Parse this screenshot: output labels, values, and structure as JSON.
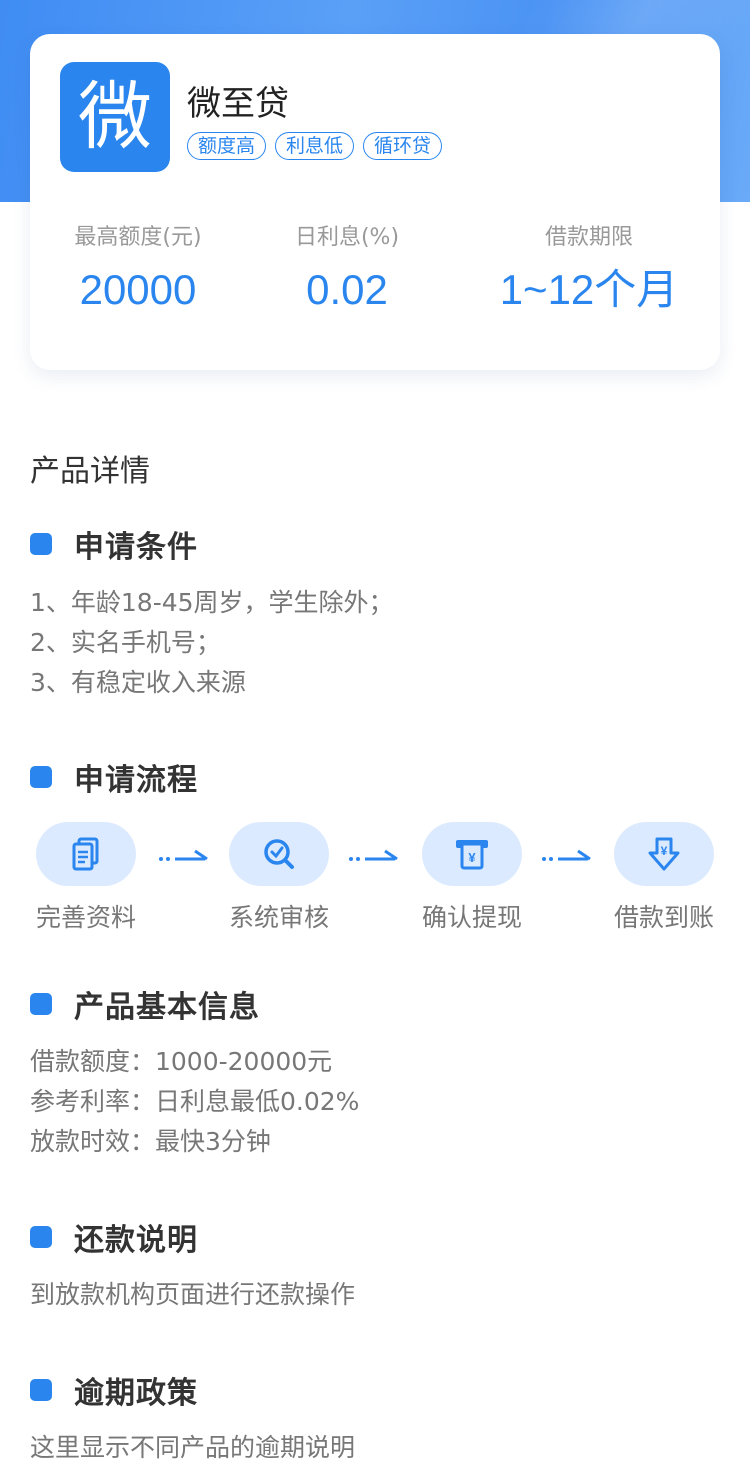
{
  "product": {
    "logo_char": "微",
    "name": "微至贷",
    "tags": [
      "额度高",
      "利息低",
      "循环贷"
    ]
  },
  "stats": [
    {
      "label": "最高额度(元)",
      "value": "20000"
    },
    {
      "label": "日利息(%)",
      "value": "0.02"
    },
    {
      "label": "借款期限",
      "value": "1~12个月"
    }
  ],
  "section_title": "产品详情",
  "conditions": {
    "title": "申请条件",
    "lines": [
      "1、年龄18-45周岁，学生除外；",
      "2、实名手机号；",
      "3、有稳定收入来源"
    ]
  },
  "process": {
    "title": "申请流程",
    "steps": [
      {
        "label": "完善资料",
        "icon": "document-icon"
      },
      {
        "label": "系统审核",
        "icon": "magnifier-check-icon"
      },
      {
        "label": "确认提现",
        "icon": "atm-withdraw-icon"
      },
      {
        "label": "借款到账",
        "icon": "arrival-down-icon"
      }
    ]
  },
  "basic_info": {
    "title": "产品基本信息",
    "lines": [
      "借款额度：1000-20000元",
      "参考利率：日利息最低0.02%",
      "放款时效：最快3分钟"
    ]
  },
  "repayment": {
    "title": "还款说明",
    "text": "到放款机构页面进行还款操作"
  },
  "overdue": {
    "title": "逾期政策",
    "text": "这里显示不同产品的逾期说明"
  },
  "colors": {
    "accent": "#2a86ee",
    "pill_bg": "#dceaff"
  }
}
